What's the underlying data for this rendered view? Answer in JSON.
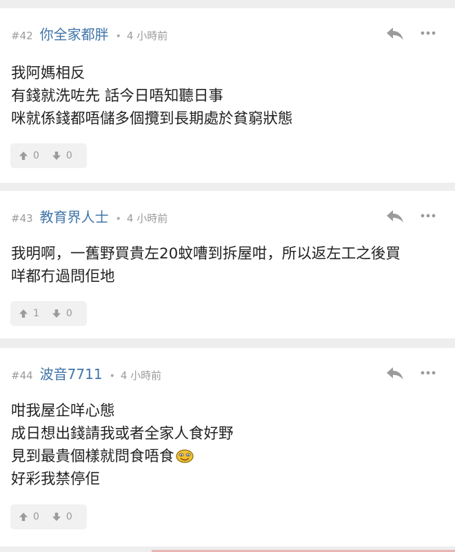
{
  "posts": [
    {
      "num": "#42",
      "user": "你全家都胖",
      "dot": "•",
      "time": "4 小時前",
      "lines": [
        "我阿媽相反",
        "有錢就洗咗先 話今日唔知聽日事",
        "咪就係錢都唔儲多個攬到長期處於貧窮狀態"
      ],
      "upvotes": "0",
      "downvotes": "0"
    },
    {
      "num": "#43",
      "user": "教育界人士",
      "dot": "•",
      "time": "4 小時前",
      "lines": [
        "我明啊，一舊野買貴左20蚊嘈到拆屋咁，所以返左工之後買",
        "咩都冇過問佢地"
      ],
      "upvotes": "1",
      "downvotes": "0"
    },
    {
      "num": "#44",
      "user": "波音7711",
      "dot": "•",
      "time": "4 小時前",
      "lines": [
        "咁我屋企咩心態",
        "成日想出錢請我或者全家人食好野",
        "見到最貴個樣就問食唔食",
        "好彩我禁停佢"
      ],
      "upvotes": "0",
      "downvotes": "0"
    }
  ],
  "colors": {
    "username": "#3f74a8",
    "meta": "#9a9a9a",
    "background": "#eeeeee"
  },
  "icons": [
    "reply-icon",
    "more-icon",
    "upvote-icon",
    "downvote-icon",
    "smiley-emoji-icon"
  ]
}
